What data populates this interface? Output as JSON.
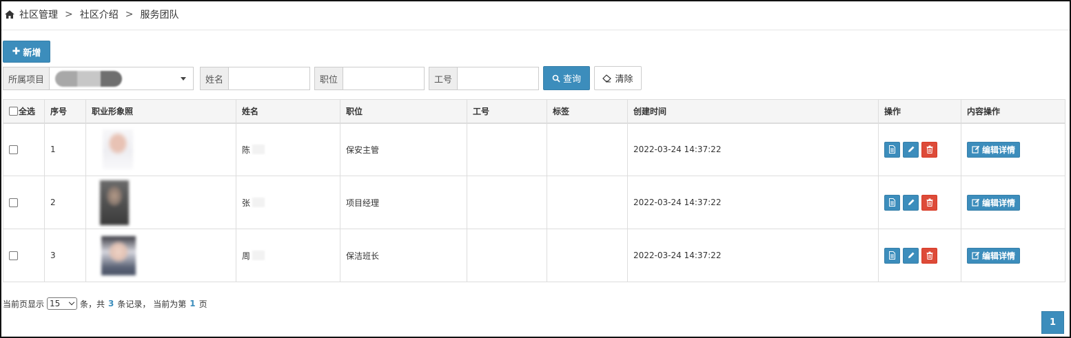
{
  "breadcrumb": {
    "items": [
      "社区管理",
      "社区介绍",
      "服务团队"
    ],
    "separator": ">"
  },
  "toolbar": {
    "add_label": "新增",
    "add_icon": "plus-icon"
  },
  "filters": {
    "project_label": "所属项目",
    "project_value": "",
    "name_label": "姓名",
    "name_value": "",
    "position_label": "职位",
    "position_value": "",
    "employee_no_label": "工号",
    "employee_no_value": "",
    "query_label": "查询",
    "clear_label": "清除"
  },
  "table": {
    "headers": {
      "select_all": "全选",
      "index": "序号",
      "photo": "职业形象照",
      "name": "姓名",
      "position": "职位",
      "employee_no": "工号",
      "tag": "标签",
      "created_at": "创建时间",
      "actions": "操作",
      "content_actions": "内容操作"
    },
    "rows": [
      {
        "index": "1",
        "name": "陈",
        "position": "保安主管",
        "employee_no": "",
        "tag": "",
        "created_at": "2022-03-24 14:37:22"
      },
      {
        "index": "2",
        "name": "张",
        "position": "项目经理",
        "employee_no": "",
        "tag": "",
        "created_at": "2022-03-24 14:37:22"
      },
      {
        "index": "3",
        "name": "周",
        "position": "保洁班长",
        "employee_no": "",
        "tag": "",
        "created_at": "2022-03-24 14:37:22"
      }
    ],
    "edit_detail_label": "编辑详情"
  },
  "pagination": {
    "prefix": "当前页显示",
    "page_size": "15",
    "mid1": "条，共",
    "total": "3",
    "mid2": "条记录， 当前为第",
    "current_page": "1",
    "suffix": "页",
    "page_button": "1"
  },
  "colors": {
    "primary": "#3c8dbc",
    "danger": "#dd4b39"
  }
}
